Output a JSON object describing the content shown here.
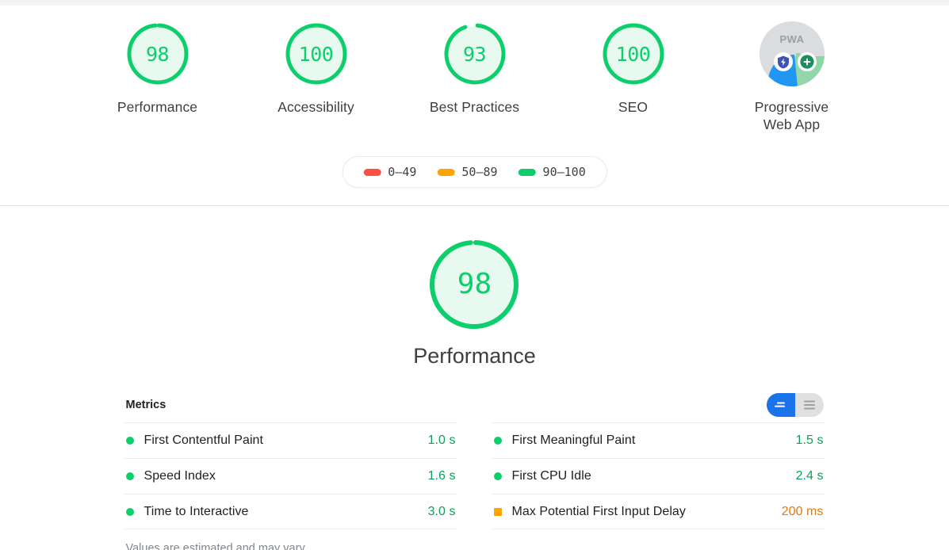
{
  "colors": {
    "pass": "#0cce6b",
    "average": "#ffa400",
    "fail": "#ff4e42",
    "pass_text": "#0b9f5b",
    "average_text": "#e07b11",
    "pass_bg": "#e8faf0",
    "blue": "#1a73e8",
    "gray_track": "#e0e0e0"
  },
  "scores_header": {
    "gauges": [
      {
        "score": "98",
        "label": "Performance",
        "rating": "pass"
      },
      {
        "score": "100",
        "label": "Accessibility",
        "rating": "pass"
      },
      {
        "score": "93",
        "label": "Best Practices",
        "rating": "pass"
      },
      {
        "score": "100",
        "label": "SEO",
        "rating": "pass"
      }
    ],
    "pwa": {
      "label_line1": "Progressive",
      "label_line2": "Web App",
      "badge_text": "PWA",
      "icon_fast_reliable": "shield-bolt-icon",
      "icon_installable": "plus-circle-icon"
    },
    "legend": [
      {
        "range": "0–49",
        "color": "#ff4e42"
      },
      {
        "range": "50–89",
        "color": "#ffa400"
      },
      {
        "range": "90–100",
        "color": "#0cce6b"
      }
    ]
  },
  "category": {
    "score": "98",
    "title": "Performance",
    "rating": "pass"
  },
  "metrics": {
    "heading": "Metrics",
    "toggle": {
      "simple_label": "simple-view-icon",
      "expanded_label": "expanded-view-icon",
      "active": "simple"
    },
    "columns": [
      [
        {
          "name": "First Contentful Paint",
          "value": "1.0 s",
          "rating": "pass"
        },
        {
          "name": "Speed Index",
          "value": "1.6 s",
          "rating": "pass"
        },
        {
          "name": "Time to Interactive",
          "value": "3.0 s",
          "rating": "pass"
        }
      ],
      [
        {
          "name": "First Meaningful Paint",
          "value": "1.5 s",
          "rating": "pass"
        },
        {
          "name": "First CPU Idle",
          "value": "2.4 s",
          "rating": "pass"
        },
        {
          "name": "Max Potential First Input Delay",
          "value": "200 ms",
          "rating": "average"
        }
      ]
    ],
    "note": "Values are estimated and may vary."
  }
}
